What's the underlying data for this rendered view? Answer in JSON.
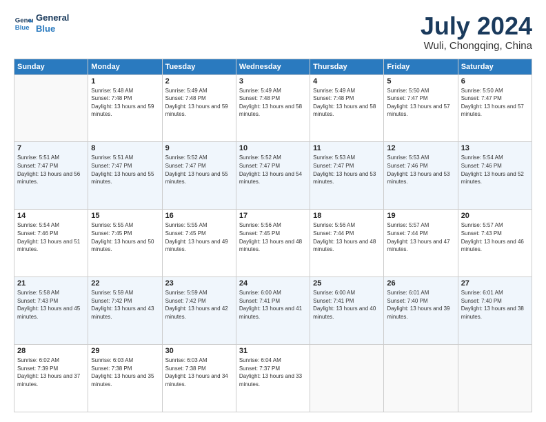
{
  "header": {
    "logo_line1": "General",
    "logo_line2": "Blue",
    "month_year": "July 2024",
    "location": "Wuli, Chongqing, China"
  },
  "weekdays": [
    "Sunday",
    "Monday",
    "Tuesday",
    "Wednesday",
    "Thursday",
    "Friday",
    "Saturday"
  ],
  "weeks": [
    [
      {
        "day": "",
        "sunrise": "",
        "sunset": "",
        "daylight": ""
      },
      {
        "day": "1",
        "sunrise": "Sunrise: 5:48 AM",
        "sunset": "Sunset: 7:48 PM",
        "daylight": "Daylight: 13 hours and 59 minutes."
      },
      {
        "day": "2",
        "sunrise": "Sunrise: 5:49 AM",
        "sunset": "Sunset: 7:48 PM",
        "daylight": "Daylight: 13 hours and 59 minutes."
      },
      {
        "day": "3",
        "sunrise": "Sunrise: 5:49 AM",
        "sunset": "Sunset: 7:48 PM",
        "daylight": "Daylight: 13 hours and 58 minutes."
      },
      {
        "day": "4",
        "sunrise": "Sunrise: 5:49 AM",
        "sunset": "Sunset: 7:48 PM",
        "daylight": "Daylight: 13 hours and 58 minutes."
      },
      {
        "day": "5",
        "sunrise": "Sunrise: 5:50 AM",
        "sunset": "Sunset: 7:47 PM",
        "daylight": "Daylight: 13 hours and 57 minutes."
      },
      {
        "day": "6",
        "sunrise": "Sunrise: 5:50 AM",
        "sunset": "Sunset: 7:47 PM",
        "daylight": "Daylight: 13 hours and 57 minutes."
      }
    ],
    [
      {
        "day": "7",
        "sunrise": "Sunrise: 5:51 AM",
        "sunset": "Sunset: 7:47 PM",
        "daylight": "Daylight: 13 hours and 56 minutes."
      },
      {
        "day": "8",
        "sunrise": "Sunrise: 5:51 AM",
        "sunset": "Sunset: 7:47 PM",
        "daylight": "Daylight: 13 hours and 55 minutes."
      },
      {
        "day": "9",
        "sunrise": "Sunrise: 5:52 AM",
        "sunset": "Sunset: 7:47 PM",
        "daylight": "Daylight: 13 hours and 55 minutes."
      },
      {
        "day": "10",
        "sunrise": "Sunrise: 5:52 AM",
        "sunset": "Sunset: 7:47 PM",
        "daylight": "Daylight: 13 hours and 54 minutes."
      },
      {
        "day": "11",
        "sunrise": "Sunrise: 5:53 AM",
        "sunset": "Sunset: 7:47 PM",
        "daylight": "Daylight: 13 hours and 53 minutes."
      },
      {
        "day": "12",
        "sunrise": "Sunrise: 5:53 AM",
        "sunset": "Sunset: 7:46 PM",
        "daylight": "Daylight: 13 hours and 53 minutes."
      },
      {
        "day": "13",
        "sunrise": "Sunrise: 5:54 AM",
        "sunset": "Sunset: 7:46 PM",
        "daylight": "Daylight: 13 hours and 52 minutes."
      }
    ],
    [
      {
        "day": "14",
        "sunrise": "Sunrise: 5:54 AM",
        "sunset": "Sunset: 7:46 PM",
        "daylight": "Daylight: 13 hours and 51 minutes."
      },
      {
        "day": "15",
        "sunrise": "Sunrise: 5:55 AM",
        "sunset": "Sunset: 7:45 PM",
        "daylight": "Daylight: 13 hours and 50 minutes."
      },
      {
        "day": "16",
        "sunrise": "Sunrise: 5:55 AM",
        "sunset": "Sunset: 7:45 PM",
        "daylight": "Daylight: 13 hours and 49 minutes."
      },
      {
        "day": "17",
        "sunrise": "Sunrise: 5:56 AM",
        "sunset": "Sunset: 7:45 PM",
        "daylight": "Daylight: 13 hours and 48 minutes."
      },
      {
        "day": "18",
        "sunrise": "Sunrise: 5:56 AM",
        "sunset": "Sunset: 7:44 PM",
        "daylight": "Daylight: 13 hours and 48 minutes."
      },
      {
        "day": "19",
        "sunrise": "Sunrise: 5:57 AM",
        "sunset": "Sunset: 7:44 PM",
        "daylight": "Daylight: 13 hours and 47 minutes."
      },
      {
        "day": "20",
        "sunrise": "Sunrise: 5:57 AM",
        "sunset": "Sunset: 7:43 PM",
        "daylight": "Daylight: 13 hours and 46 minutes."
      }
    ],
    [
      {
        "day": "21",
        "sunrise": "Sunrise: 5:58 AM",
        "sunset": "Sunset: 7:43 PM",
        "daylight": "Daylight: 13 hours and 45 minutes."
      },
      {
        "day": "22",
        "sunrise": "Sunrise: 5:59 AM",
        "sunset": "Sunset: 7:42 PM",
        "daylight": "Daylight: 13 hours and 43 minutes."
      },
      {
        "day": "23",
        "sunrise": "Sunrise: 5:59 AM",
        "sunset": "Sunset: 7:42 PM",
        "daylight": "Daylight: 13 hours and 42 minutes."
      },
      {
        "day": "24",
        "sunrise": "Sunrise: 6:00 AM",
        "sunset": "Sunset: 7:41 PM",
        "daylight": "Daylight: 13 hours and 41 minutes."
      },
      {
        "day": "25",
        "sunrise": "Sunrise: 6:00 AM",
        "sunset": "Sunset: 7:41 PM",
        "daylight": "Daylight: 13 hours and 40 minutes."
      },
      {
        "day": "26",
        "sunrise": "Sunrise: 6:01 AM",
        "sunset": "Sunset: 7:40 PM",
        "daylight": "Daylight: 13 hours and 39 minutes."
      },
      {
        "day": "27",
        "sunrise": "Sunrise: 6:01 AM",
        "sunset": "Sunset: 7:40 PM",
        "daylight": "Daylight: 13 hours and 38 minutes."
      }
    ],
    [
      {
        "day": "28",
        "sunrise": "Sunrise: 6:02 AM",
        "sunset": "Sunset: 7:39 PM",
        "daylight": "Daylight: 13 hours and 37 minutes."
      },
      {
        "day": "29",
        "sunrise": "Sunrise: 6:03 AM",
        "sunset": "Sunset: 7:38 PM",
        "daylight": "Daylight: 13 hours and 35 minutes."
      },
      {
        "day": "30",
        "sunrise": "Sunrise: 6:03 AM",
        "sunset": "Sunset: 7:38 PM",
        "daylight": "Daylight: 13 hours and 34 minutes."
      },
      {
        "day": "31",
        "sunrise": "Sunrise: 6:04 AM",
        "sunset": "Sunset: 7:37 PM",
        "daylight": "Daylight: 13 hours and 33 minutes."
      },
      {
        "day": "",
        "sunrise": "",
        "sunset": "",
        "daylight": ""
      },
      {
        "day": "",
        "sunrise": "",
        "sunset": "",
        "daylight": ""
      },
      {
        "day": "",
        "sunrise": "",
        "sunset": "",
        "daylight": ""
      }
    ]
  ]
}
